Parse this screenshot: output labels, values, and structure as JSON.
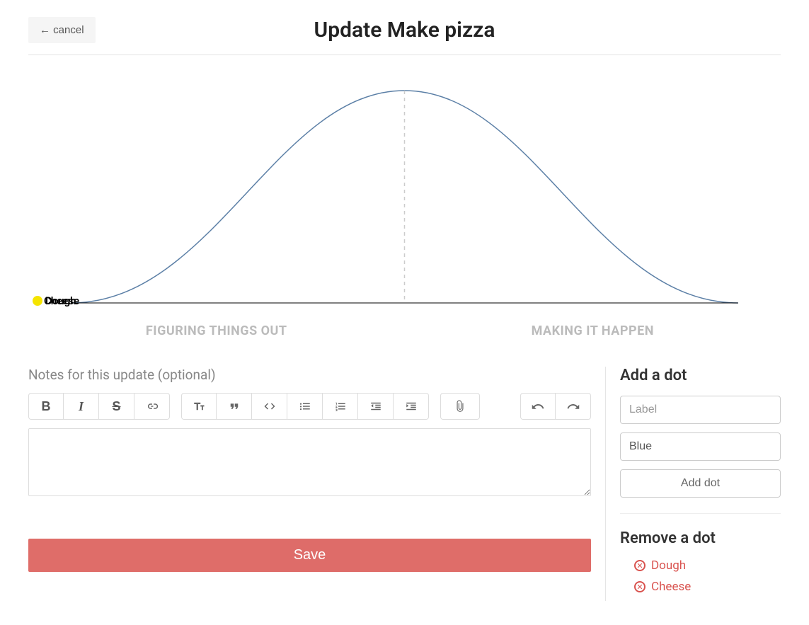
{
  "header": {
    "cancel_label": "←  cancel",
    "title": "Update Make pizza"
  },
  "chart_data": {
    "type": "line",
    "title": "",
    "xlabel_left": "FIGURING THINGS OUT",
    "xlabel_right": "MAKING IT HAPPEN",
    "x_range": [
      0,
      100
    ],
    "y_range": [
      0,
      100
    ],
    "curve": [
      {
        "x": 0,
        "y": 1
      },
      {
        "x": 10,
        "y": 6
      },
      {
        "x": 20,
        "y": 22
      },
      {
        "x": 30,
        "y": 50
      },
      {
        "x": 40,
        "y": 82
      },
      {
        "x": 45,
        "y": 94
      },
      {
        "x": 50,
        "y": 100
      },
      {
        "x": 55,
        "y": 94
      },
      {
        "x": 60,
        "y": 82
      },
      {
        "x": 70,
        "y": 50
      },
      {
        "x": 80,
        "y": 22
      },
      {
        "x": 90,
        "y": 6
      },
      {
        "x": 100,
        "y": 1
      }
    ],
    "dots": [
      {
        "label": "Dough",
        "x": 0,
        "y": 0,
        "color": "#f5e400"
      },
      {
        "label": "Cheese",
        "x": 0,
        "y": 0,
        "color": "#f5e400"
      }
    ]
  },
  "notes": {
    "label": "Notes for this update (optional)",
    "value": ""
  },
  "toolbar": {
    "bold": "B",
    "italic": "I",
    "strike": "S"
  },
  "actions": {
    "save_label": "Save"
  },
  "sidebar": {
    "add_heading": "Add a dot",
    "label_placeholder": "Label",
    "color_value": "Blue",
    "add_button": "Add dot",
    "remove_heading": "Remove a dot",
    "remove_items": [
      "Dough",
      "Cheese"
    ]
  }
}
